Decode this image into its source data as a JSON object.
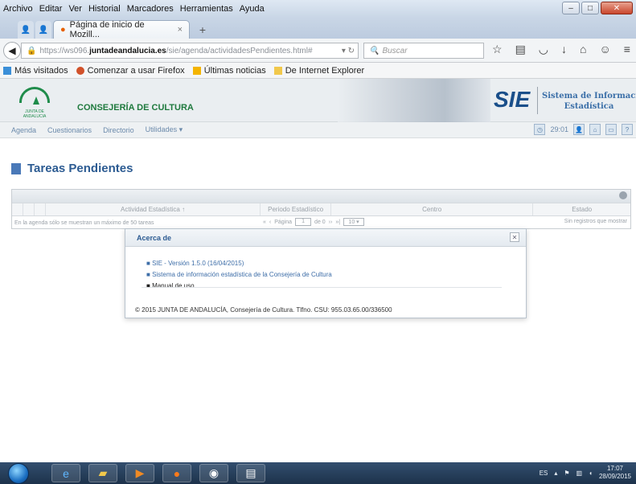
{
  "browser": {
    "menu": [
      "Archivo",
      "Editar",
      "Ver",
      "Historial",
      "Marcadores",
      "Herramientas",
      "Ayuda"
    ],
    "tab_title": "Página de inicio de Mozill...",
    "url_prefix": "https://ws096.",
    "url_domain": "juntadeandalucia.es",
    "url_path": "/sie/agenda/actividadesPendientes.html#",
    "search_placeholder": "Buscar",
    "bookmarks": [
      "Más visitados",
      "Comenzar a usar Firefox",
      "Últimas noticias",
      "De Internet Explorer"
    ]
  },
  "site": {
    "logo_caption": "JUNTA DE ANDALUCIA",
    "department": "CONSEJERÍA DE CULTURA",
    "sie_logo": "SIE",
    "sie_title_line1": "Sistema de Información",
    "sie_title_line2": "Estadística",
    "nav": [
      "Agenda",
      "Cuestionarios",
      "Directorio",
      "Utilidades ▾"
    ],
    "session_time": "29:01"
  },
  "page": {
    "title": "Tareas Pendientes"
  },
  "grid": {
    "columns": [
      "Actividad Estadística ↑",
      "Periodo Estadístico",
      "Centro",
      "Estado"
    ],
    "agenda_note": "En la agenda sólo se muestran un máximo de 50 tareas",
    "page_label": "Página",
    "page_value": "1",
    "page_of": "de 0",
    "rows_per_page": "10",
    "no_records": "Sin registros que mostrar"
  },
  "dialog": {
    "title": "Acerca de",
    "items": [
      "SIE - Versión 1.5.0 (16/04/2015)",
      "Sistema de información estadística de la Consejería de Cultura",
      "Manual de uso"
    ],
    "footer": "© 2015 JUNTA DE ANDALUCÍA, Consejería de Cultura. Tlfno. CSU: 955.03.65.00/336500"
  },
  "taskbar": {
    "lang": "ES",
    "time": "17:07",
    "date": "28/09/2015"
  },
  "colors": {
    "accent": "#2c5b92",
    "green": "#1f7a3e"
  }
}
